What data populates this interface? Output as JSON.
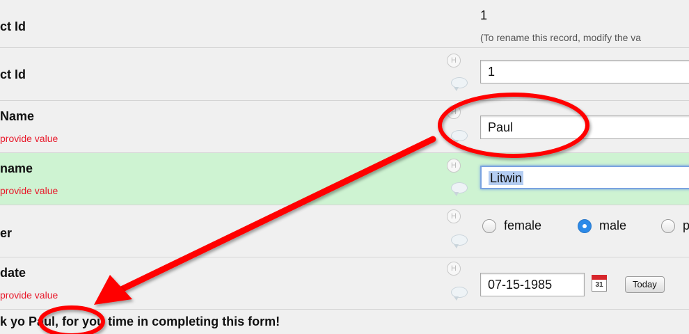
{
  "rows": {
    "record": {
      "label": "ct Id",
      "value": "1",
      "note": "(To rename this record, modify the va"
    },
    "contact": {
      "label": "ct Id",
      "value": "1"
    },
    "first": {
      "label": "Name",
      "required": "provide value",
      "value": "Paul"
    },
    "last": {
      "label": "name",
      "required": "provide value",
      "value": "Litwin"
    },
    "gender": {
      "label": "er",
      "options": [
        "female",
        "male",
        "p"
      ],
      "selected": "male"
    },
    "date": {
      "label": "date",
      "required": "provide value",
      "value": "07-15-1985",
      "calendar_day": "31",
      "today_label": "Today"
    }
  },
  "icons": {
    "history": "H",
    "comment": "comment-bubble-icon"
  },
  "thanks": {
    "prefix": "k yo",
    "name": "Paul,",
    "rest": " for you time in completing this form!"
  },
  "colors": {
    "highlight_row": "#cef3d2",
    "required_text": "#e8182a",
    "annotation": "#ff0000",
    "radio_on": "#2c8ae8"
  }
}
